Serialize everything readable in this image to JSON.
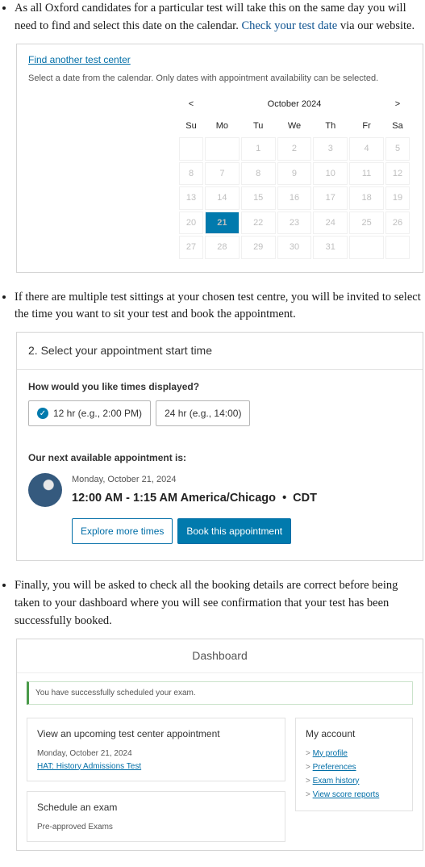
{
  "bullets": {
    "b1_pre": "As all Oxford candidates for a particular test will take this on the same day you will need to find and select this date on the calendar. ",
    "b1_link": "Check your test date",
    "b1_post": " via our website.",
    "b2": "If there are multiple test sittings at your chosen test centre, you will be invited to select the time you want to sit your test and book the appointment.",
    "b3": "Finally, you will be asked to check all the booking details are correct before being taken to your dashboard where you will see confirmation that your test has been successfully booked."
  },
  "calendar": {
    "find_link": "Find another test center",
    "note": "Select a date from the calendar. Only dates with appointment availability can be selected.",
    "prev": "<",
    "next": ">",
    "month": "October 2024",
    "dow": [
      "Su",
      "Mo",
      "Tu",
      "We",
      "Th",
      "Fr",
      "Sa"
    ],
    "weeks": [
      [
        "",
        "",
        "1",
        "2",
        "3",
        "4",
        "5"
      ],
      [
        "8",
        "7",
        "8",
        "9",
        "10",
        "11",
        "12"
      ],
      [
        "13",
        "14",
        "15",
        "16",
        "17",
        "18",
        "19"
      ],
      [
        "20",
        "21",
        "22",
        "23",
        "24",
        "25",
        "26"
      ],
      [
        "27",
        "28",
        "29",
        "30",
        "31",
        "",
        ""
      ]
    ],
    "selected": "21"
  },
  "appt": {
    "heading": "2. Select your appointment start time",
    "question": "How would you like times displayed?",
    "opt12": "12 hr (e.g., 2:00 PM)",
    "opt24": "24 hr (e.g., 14:00)",
    "next_label": "Our next available appointment is:",
    "slot_date": "Monday, October 21, 2024",
    "slot_time": "12:00 AM - 1:15 AM America/Chicago",
    "slot_tz": "CDT",
    "explore": "Explore more times",
    "book": "Book this appointment"
  },
  "dash": {
    "title": "Dashboard",
    "success": "You have successfully scheduled your exam.",
    "upcoming_title": "View an upcoming test center appointment",
    "upcoming_date": "Monday, October 21, 2024",
    "upcoming_link": "HAT: History Admissions Test",
    "schedule_title": "Schedule an exam",
    "schedule_sub": "Pre-approved Exams",
    "account_title": "My account",
    "links": [
      "My profile",
      "Preferences",
      "Exam history",
      "View score reports"
    ]
  }
}
